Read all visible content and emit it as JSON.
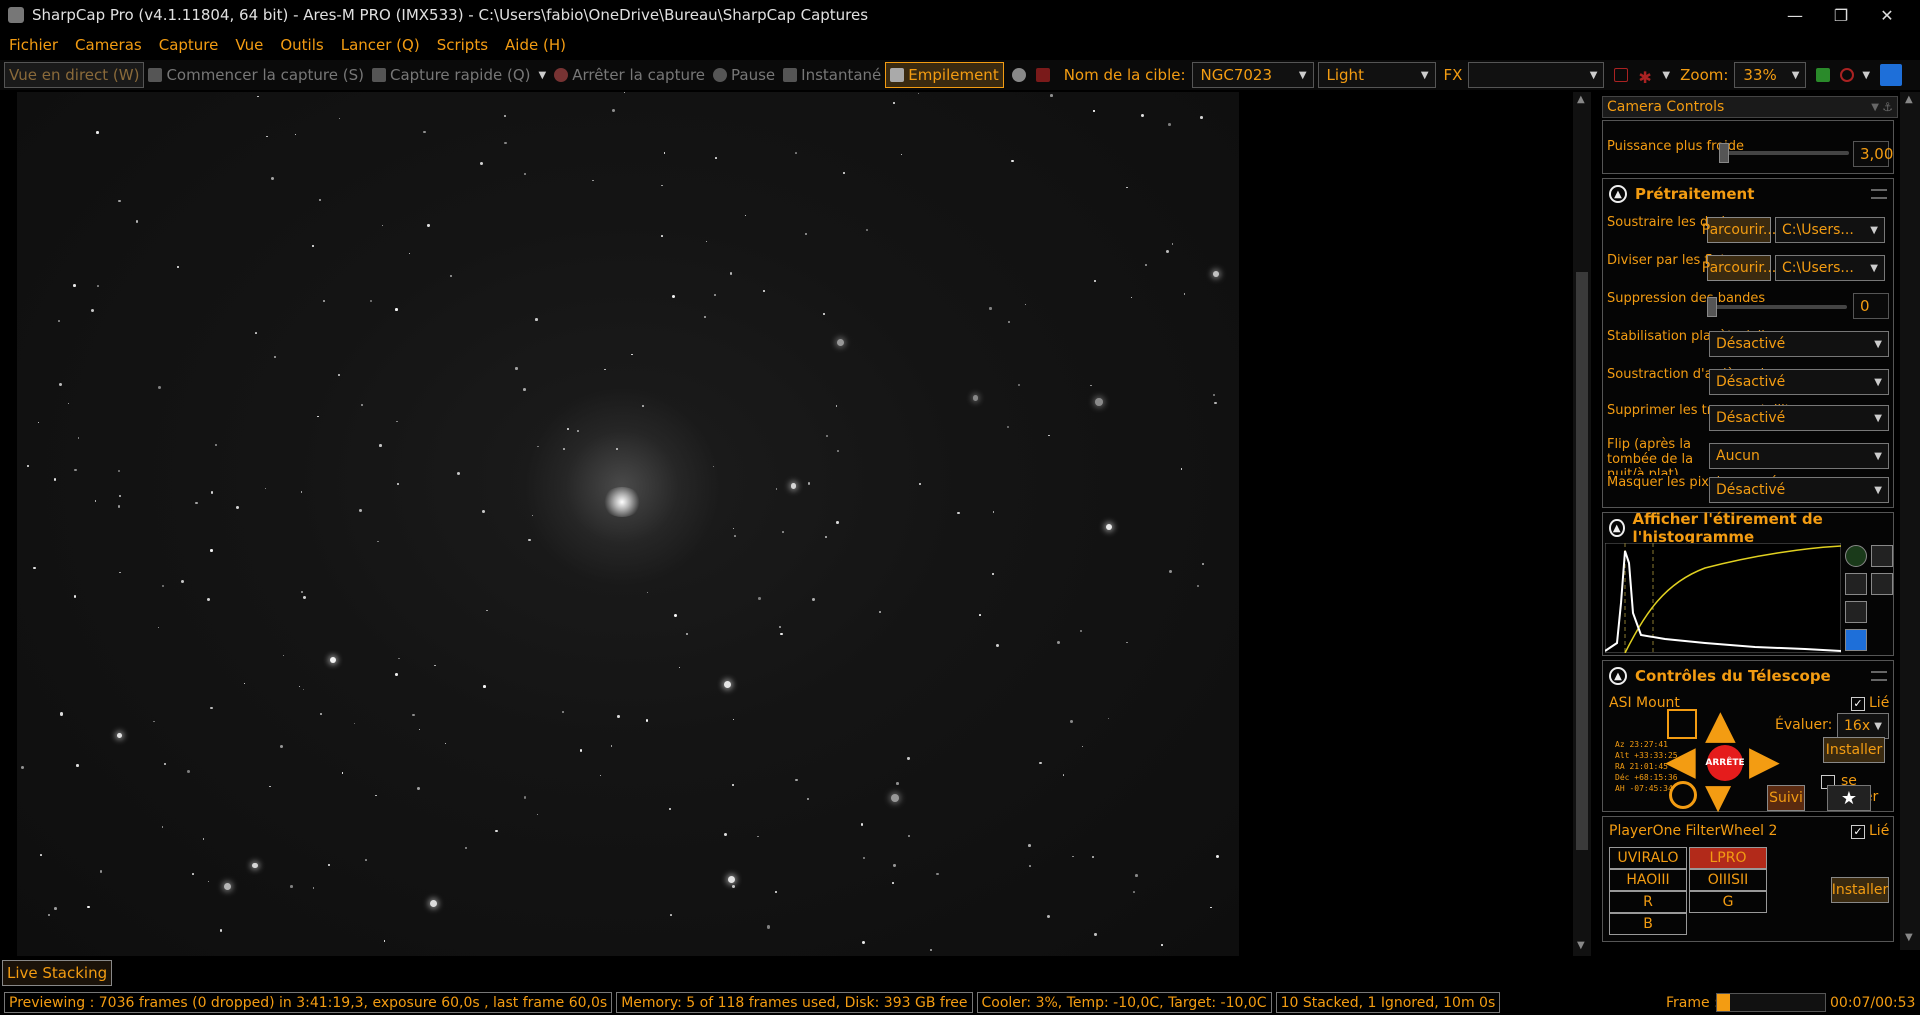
{
  "window": {
    "title": "SharpCap Pro (v4.1.11804, 64 bit) - Ares-M PRO (IMX533) - C:\\Users\\fabio\\OneDrive\\Bureau\\SharpCap Captures"
  },
  "menu": [
    "Fichier",
    "Cameras",
    "Capture",
    "Vue",
    "Outils",
    "Lancer (Q)",
    "Scripts",
    "Aide (H)"
  ],
  "toolbar": {
    "live_view": "Vue en direct (W)",
    "start_capture": "Commencer la capture (S)",
    "quick_capture": "Capture rapide (Q)",
    "stop_capture": "Arrêter la capture",
    "pause": "Pause",
    "snapshot": "Instantané",
    "stacking": "Empilement",
    "target_label": "Nom de la cible:",
    "target_value": "NGC7023",
    "frame_type": "Light",
    "fx_label": "FX",
    "fx_value": "",
    "zoom_label": "Zoom:",
    "zoom_value": "33%"
  },
  "panel": {
    "header": "Camera Controls",
    "cooler_label": "Puissance plus froide",
    "cooler_value": "3,00",
    "pre": {
      "title": "Prétraitement",
      "darks_label": "Soustraire les darks",
      "flats_label": "Diviser par les flats",
      "browse": "Parcourir...",
      "path": "C:\\Users...",
      "banding_label": "Suppression des bandes",
      "banding_value": "0",
      "stab_label": "Stabilisation planète / disque",
      "bg_label": "Soustraction d'arrière-plan",
      "sat_label": "Supprimer les traces satellites",
      "flip_label": "Flip (après la tombée de la nuit/à plat)",
      "mask_label": "Masquer les pixels exposés",
      "disabled": "Désactivé",
      "none": "Aucun"
    },
    "histo": {
      "title": "Afficher l'étirement de l'histogramme"
    },
    "tele": {
      "title": "Contrôles du Télescope",
      "mount": "ASI Mount",
      "linked": "Lié",
      "rate_label": "Évaluer:",
      "rate_value": "16x",
      "install": "Installer",
      "park": "se garer",
      "stop": "ARRÊTE",
      "track": "Suivi",
      "coords": [
        "Az    23:27:41",
        "Alt  +33:33:25",
        "RA    21:01:45",
        "Déc  +68:15:36",
        "AH   -07:45:34"
      ]
    },
    "filter": {
      "title": "PlayerOne FilterWheel 2",
      "linked": "Lié",
      "install": "Installer",
      "filters": [
        "UVIRALO",
        "LPRO",
        "HAOIII",
        "OIIISII",
        "R",
        "G",
        "B"
      ]
    }
  },
  "live_stacking": "Live Stacking",
  "status": {
    "preview": "Previewing : 7036 frames (0 dropped) in 3:41:19,3, exposure 60,0s , last frame 60,0s",
    "memory": "Memory: 5 of 118 frames used, Disk: 393 GB free",
    "cooler": "Cooler: 3%, Temp: -10,0C, Target: -10,0C",
    "stack": "10 Stacked, 1 Ignored, 10m 0s",
    "frame_label": "Frame :",
    "time": "00:07/00:53",
    "frame_progress": 0.12
  },
  "colors": {
    "accent": "#f39c12",
    "stop": "#e51c1c"
  }
}
